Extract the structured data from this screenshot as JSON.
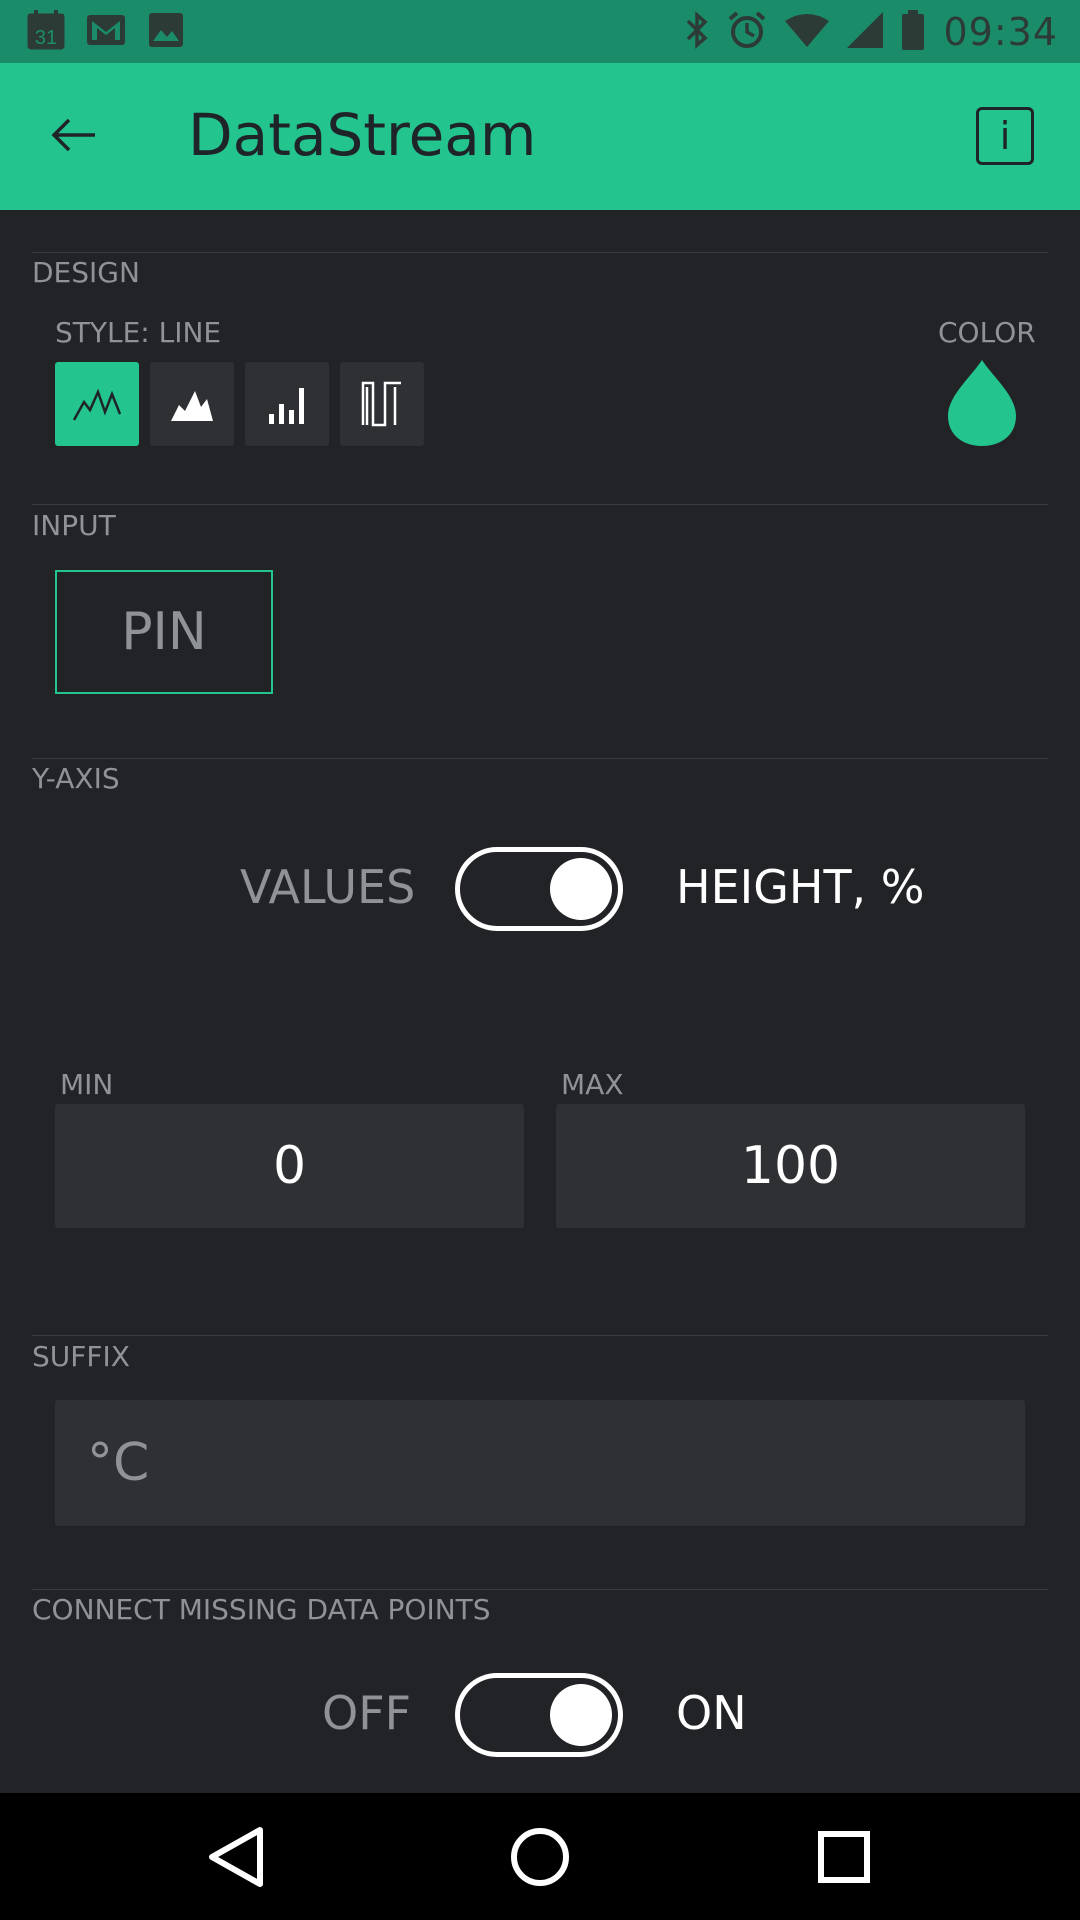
{
  "status_bar": {
    "time": "09:34",
    "calendar_day": "31",
    "icons": [
      "calendar-icon",
      "gmail-icon",
      "image-icon",
      "bluetooth-icon",
      "alarm-icon",
      "wifi-icon",
      "signal-icon",
      "battery-icon"
    ]
  },
  "app_bar": {
    "title": "DataStream",
    "info_label": "i"
  },
  "design": {
    "section_label": "DESIGN",
    "style_label": "STYLE: LINE",
    "color_label": "COLOR",
    "styles": [
      "line",
      "area",
      "bar",
      "binary"
    ],
    "selected_style": "line",
    "color": "#23c48e"
  },
  "input": {
    "section_label": "INPUT",
    "pin_label": "PIN"
  },
  "y_axis": {
    "section_label": "Y-AXIS",
    "left_option": "VALUES",
    "right_option": "HEIGHT, %",
    "min_label": "MIN",
    "max_label": "MAX",
    "min_value": "0",
    "max_value": "100"
  },
  "suffix": {
    "section_label": "SUFFIX",
    "value": "°C"
  },
  "connect_missing": {
    "section_label": "CONNECT MISSING DATA POINTS",
    "off_label": "OFF",
    "on_label": "ON"
  },
  "colors": {
    "accent": "#23c48e",
    "background": "#222326",
    "field": "#2e3034",
    "status_bar": "#1b8c69"
  }
}
